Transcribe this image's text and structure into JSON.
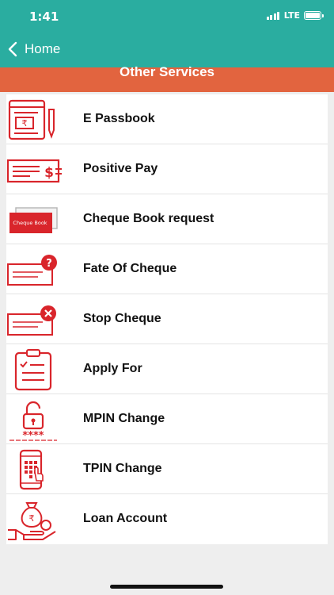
{
  "status_bar": {
    "time": "1:41",
    "network": "LTE"
  },
  "nav": {
    "back_label": "Home"
  },
  "header": {
    "title": "Other Services"
  },
  "colors": {
    "teal": "#2aada0",
    "orange": "#e2643f",
    "red": "#d9252b"
  },
  "services": [
    {
      "label": "E Passbook",
      "icon": "passbook-icon"
    },
    {
      "label": "Positive Pay",
      "icon": "cheque-dollar-icon"
    },
    {
      "label": "Cheque Book request",
      "icon": "cheque-book-icon",
      "icon_text": "Cheque Book"
    },
    {
      "label": "Fate Of Cheque",
      "icon": "cheque-question-icon",
      "icon_text": "?"
    },
    {
      "label": "Stop Cheque",
      "icon": "cheque-cancel-icon"
    },
    {
      "label": "Apply For",
      "icon": "clipboard-checklist-icon"
    },
    {
      "label": "MPIN Change",
      "icon": "padlock-pin-icon",
      "icon_text": "****"
    },
    {
      "label": "TPIN Change",
      "icon": "phone-keypad-icon"
    },
    {
      "label": "Loan Account",
      "icon": "money-bag-hand-icon"
    }
  ]
}
